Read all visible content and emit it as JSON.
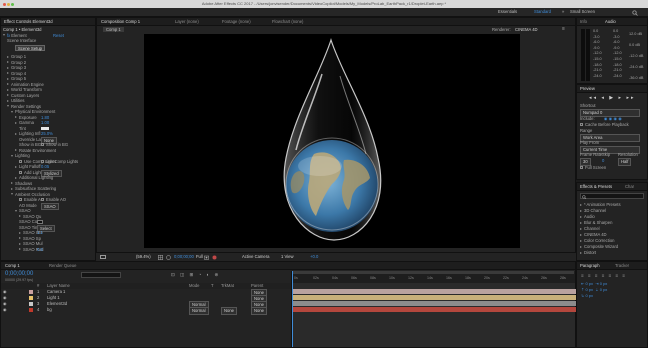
{
  "app": {
    "title": "Adobe After Effects CC 2017 - /Users/jonvisender/Documents/VideoCopilot/Models/My_Models/ProLab_EarthPack_r1/Droplet-Earth.aep *"
  },
  "workspace": {
    "tabs": [
      "Essentials",
      "Standard",
      "Small Screen"
    ],
    "active": "Standard"
  },
  "effect_controls": {
    "tab_label": "Effect Controls Element3d",
    "breadcrumb": "Comp 1 • Element3d",
    "effect_name": "Element",
    "reset_label": "Reset",
    "scene_interface_label": "Scene Interface",
    "scene_setup_button": "Scene Setup",
    "groups": [
      "Group 1",
      "Group 2",
      "Group 3",
      "Group 4",
      "Group 5"
    ],
    "sections": [
      "Animation Engine",
      "World Transform",
      "Custom Layers",
      "Utilities",
      "Render Settings"
    ],
    "physical_env_label": "Physical Environment",
    "exposure": {
      "label": "Exposure",
      "value": "1.80"
    },
    "gamma": {
      "label": "Gamma",
      "value": "1.00"
    },
    "tint_label": "Tint",
    "lighting_infl": {
      "label": "Lighting Infl",
      "value": "25.0%"
    },
    "override_layer": {
      "label": "Override Layer",
      "value": "None"
    },
    "show_bg_label": "Show in BG",
    "rotate_env_label": "Rotate Environment",
    "lighting_label": "Lighting",
    "use_comp_lights": "Use Comp Lights",
    "light_falloff": {
      "label": "Light Falloff",
      "value": "0.05"
    },
    "add_lighting": {
      "label": "Add Lighting",
      "value": "Stylized"
    },
    "additional_lighting": "Additional Lighting",
    "shadows": "Shadows",
    "subsurface": "Subsurface Scattering",
    "ambient_occlusion": "Ambient Occlusion",
    "enable_ao": "Enable AO",
    "enable_ao2": "Enable AO",
    "ao_mode": {
      "label": "AO Mode",
      "value": "SSAO"
    },
    "ssao": "SSAO",
    "ssao_rows": [
      "SSAO Qu",
      "SSAO Col",
      "SSAO Tint",
      "SSAO Inte",
      "SSAO Sp",
      "SSAO Mul",
      "SSAO Rad"
    ],
    "ssao_vals": [
      "",
      "",
      "",
      "1.1",
      "",
      "",
      "0.5"
    ],
    "ssao_sel": "Select"
  },
  "viewer": {
    "tabs": [
      "Composition Comp 1",
      "Layer (none)",
      "Footage (none)",
      "Flowchart (none)"
    ],
    "comp_tab": "Comp 1",
    "renderer_label": "Renderer:",
    "renderer_value": "CINEMA 4D",
    "zoom": "(59.4%)",
    "resolution": "Full",
    "camera": "Active Camera",
    "view": "1 View",
    "exposure": "+0.0",
    "timecode": "0;00;00;00"
  },
  "info": {
    "tab_info": "Info",
    "tab_audio": "Audio",
    "db_left": [
      "0.0",
      "-3.0",
      "-6.0",
      "-9.0",
      "-12.0",
      "-15.0",
      "-18.0",
      "-21.0",
      "-24.0"
    ],
    "db_right": [
      "12.0 dB",
      "0.0 dB",
      "-12.0 dB",
      "-24.0 dB",
      "-36.0 dB"
    ],
    "db_mid": [
      "0.0",
      "-3.0",
      "-6.0",
      "-9.0",
      "-12.0",
      "-15.0",
      "-18.0",
      "-21.0",
      "-24.0"
    ]
  },
  "preview": {
    "title": "Preview",
    "shortcut_label": "Shortcut",
    "shortcut_value": "Numpad 0",
    "include_label": "Include:",
    "cache_label": "Cache Before Playback",
    "range_label": "Range",
    "range_value": "Work Area",
    "play_from_label": "Play From",
    "play_from_value": "Current Time",
    "frame_rate_label": "Frame Rate",
    "skip_label": "Skip",
    "resolution_label": "Resolution",
    "frame_rate_value": "30",
    "skip_value": "0",
    "resolution_value": "Half",
    "full_screen_label": "Full Screen"
  },
  "effects_presets": {
    "tabs": [
      "Effects & Presets",
      "Char"
    ],
    "items": [
      "* Animation Presets",
      "3D Channel",
      "Audio",
      "Blur & Sharpen",
      "Channel",
      "CINEMA 4D",
      "Color Correction",
      "Composite Wizard",
      "Distort"
    ]
  },
  "paragraph": {
    "tabs": [
      "Paragraph",
      "Tracker"
    ]
  },
  "timeline": {
    "tabs": [
      "Comp 1",
      "Render Queue"
    ],
    "timecode": "0;00;00;00",
    "fps": "00000 (29.97 fps)",
    "header_cols": [
      "#",
      "Layer Name",
      "Mode",
      "T",
      "TrkMat",
      "Parent"
    ],
    "layers": [
      {
        "num": "1",
        "name": "Camera 1",
        "color": "#c9a0a0",
        "mode": "",
        "trkmat": "",
        "parent": "None"
      },
      {
        "num": "2",
        "name": "Light 1",
        "color": "#e7c36b",
        "mode": "",
        "trkmat": "",
        "parent": "None"
      },
      {
        "num": "3",
        "name": "Element3d",
        "color": "#c8c8c8",
        "mode": "Normal",
        "trkmat": "",
        "parent": "None"
      },
      {
        "num": "4",
        "name": "bg",
        "color": "#c0392b",
        "mode": "Normal",
        "trkmat": "None",
        "parent": "None"
      }
    ],
    "ruler_marks": [
      "0s",
      "02s",
      "04s",
      "06s",
      "08s",
      "10s",
      "12s",
      "14s",
      "16s",
      "18s",
      "20s",
      "22s",
      "24s",
      "26s",
      "28s"
    ],
    "bar_colors": [
      "#b9a29f",
      "#c8b07a",
      "#8c8c8c",
      "#b4473d"
    ]
  },
  "colors": {
    "accent": "#3f8cd8",
    "panel": "#232323",
    "bg": "#1b1b1b"
  }
}
